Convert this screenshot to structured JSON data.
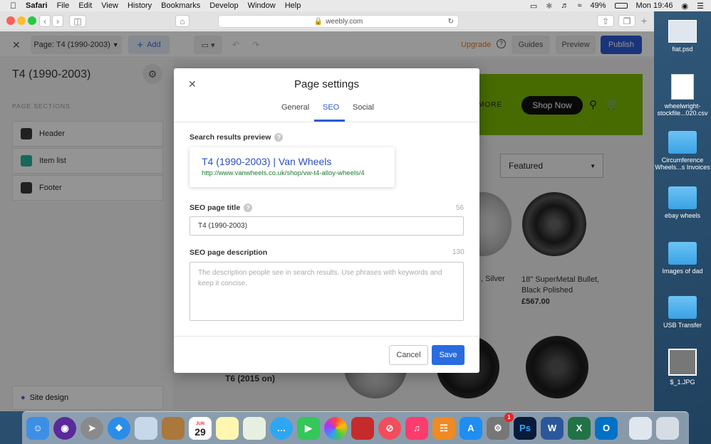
{
  "menubar": {
    "app": "Safari",
    "items": [
      "File",
      "Edit",
      "View",
      "History",
      "Bookmarks",
      "Develop",
      "Window",
      "Help"
    ],
    "battery": "49%",
    "clock": "Mon 19:46"
  },
  "browser": {
    "url": "weebly.com"
  },
  "editor": {
    "page_selector": "Page: T4 (1990-2003)",
    "add_label": "Add",
    "upgrade": "Upgrade",
    "guides": "Guides",
    "preview": "Preview",
    "publish": "Publish",
    "sidebar_title": "T4 (1990-2003)",
    "sections_heading": "PAGE SECTIONS",
    "sections": [
      {
        "label": "Header",
        "color": "#3a3a3a"
      },
      {
        "label": "Item list",
        "color": "#26b59a"
      },
      {
        "label": "Footer",
        "color": "#3a3a3a"
      }
    ],
    "site_design": "Site design"
  },
  "site_preview": {
    "more": "MORE",
    "shop_now": "Shop Now",
    "sort_select": "Featured",
    "products": [
      {
        "name_fragment": ", Silver"
      },
      {
        "name": "18\" SuperMetal Bullet, Black Polished",
        "price": "£567.00"
      }
    ],
    "category": "T6 (2015 on)",
    "accent": "#7ab800"
  },
  "modal": {
    "title": "Page settings",
    "tabs": [
      "General",
      "SEO",
      "Social"
    ],
    "active_tab": "SEO",
    "preview_label": "Search results preview",
    "preview_title": "T4 (1990-2003) | Van Wheels",
    "preview_url": "http://www.vanwheels.co.uk/shop/vw-t4-alloy-wheels/4",
    "seo_title_label": "SEO page title",
    "seo_title_count": "56",
    "seo_title_value": "T4 (1990-2003)",
    "seo_desc_label": "SEO page description",
    "seo_desc_count": "130",
    "seo_desc_placeholder": "The description people see in search results. Use phrases with keywords and keep it concise.",
    "cancel": "Cancel",
    "save": "Save"
  },
  "desktop_icons": [
    {
      "label": "fiat.psd"
    },
    {
      "label": "wheelwright-stockfile...020.csv"
    },
    {
      "label": "Circumference Wheels...s Invoices"
    },
    {
      "label": "ebay wheels"
    },
    {
      "label": "Images of dad"
    },
    {
      "label": "USB Transfer"
    },
    {
      "label": "$_1.JPG"
    }
  ],
  "dock": {
    "calendar_month": "JUN",
    "calendar_day": "29",
    "badge": "1"
  }
}
